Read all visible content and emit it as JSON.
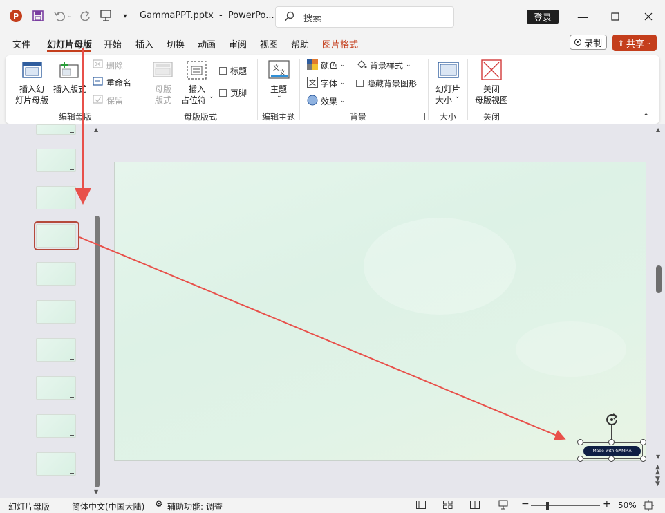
{
  "titlebar": {
    "filename": "GammaPPT.pptx",
    "separator": "-",
    "app": "PowerPo...",
    "search_placeholder": "搜索",
    "login": "登录"
  },
  "tabs": [
    "文件",
    "幻灯片母版",
    "开始",
    "插入",
    "切换",
    "动画",
    "审阅",
    "视图",
    "帮助",
    "图片格式"
  ],
  "tabs_active": "幻灯片母版",
  "record": "录制",
  "share": "共享",
  "ribbon": {
    "insert_master": "插入幻\n灯片母版",
    "insert_master_l1": "插入幻",
    "insert_master_l2": "灯片母版",
    "insert_layout": "插入版式",
    "delete": "删除",
    "rename": "重命名",
    "preserve": "保留",
    "group_edit_master": "编辑母版",
    "master_layout_l1": "母版",
    "master_layout_l2": "版式",
    "insert_placeholder_l1": "插入",
    "insert_placeholder_l2": "占位符",
    "title_cb": "标题",
    "footer_cb": "页脚",
    "group_master_layout": "母版版式",
    "theme": "主题",
    "group_edit_theme": "编辑主题",
    "colors": "颜色",
    "fonts": "字体",
    "effects": "效果",
    "bg_styles": "背景样式",
    "hide_bg": "隐藏背景图形",
    "group_background": "背景",
    "slide_size_l1": "幻灯片",
    "slide_size_l2": "大小",
    "group_size": "大小",
    "close_master_l1": "关闭",
    "close_master_l2": "母版视图",
    "group_close": "关闭"
  },
  "slide": {
    "badge_text": "Made with GAMMA"
  },
  "statusbar": {
    "view": "幻灯片母版",
    "language": "简体中文(中国大陆)",
    "accessibility": "辅助功能: 调查",
    "zoom": "50%"
  },
  "colors": {
    "accent_red": "#c43e1c",
    "arrow_red": "#e8504a",
    "selected_border": "#b54a3b"
  }
}
